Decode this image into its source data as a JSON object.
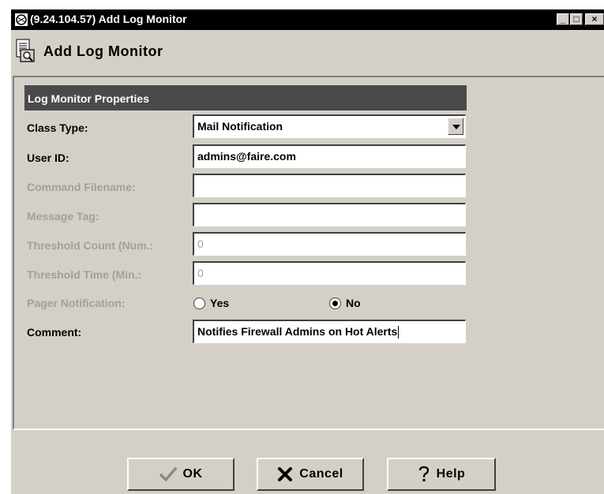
{
  "window": {
    "title": "(9.24.104.57) Add Log Monitor",
    "controls": {
      "minimize": "_",
      "maximize": "□",
      "close": "×"
    }
  },
  "header": {
    "title": "Add Log Monitor",
    "icon": "log-monitor-icon"
  },
  "section": {
    "title": "Log Monitor Properties"
  },
  "form": {
    "class_type": {
      "label": "Class Type:",
      "value": "Mail Notification"
    },
    "user_id": {
      "label": "User ID:",
      "value": "admins@faire.com"
    },
    "command_filename": {
      "label": "Command Filename:",
      "value": ""
    },
    "message_tag": {
      "label": "Message Tag:",
      "value": ""
    },
    "threshold_count": {
      "label": "Threshold Count (Num.:",
      "value": "0"
    },
    "threshold_time": {
      "label": "Threshold Time (Min.:",
      "value": "0"
    },
    "pager_notification": {
      "label": "Pager Notification:",
      "yes_label": "Yes",
      "no_label": "No",
      "selected": "No"
    },
    "comment": {
      "label": "Comment:",
      "value": "Notifies Firewall Admins on Hot Alerts"
    }
  },
  "buttons": {
    "ok": "OK",
    "cancel": "Cancel",
    "help": "Help"
  }
}
